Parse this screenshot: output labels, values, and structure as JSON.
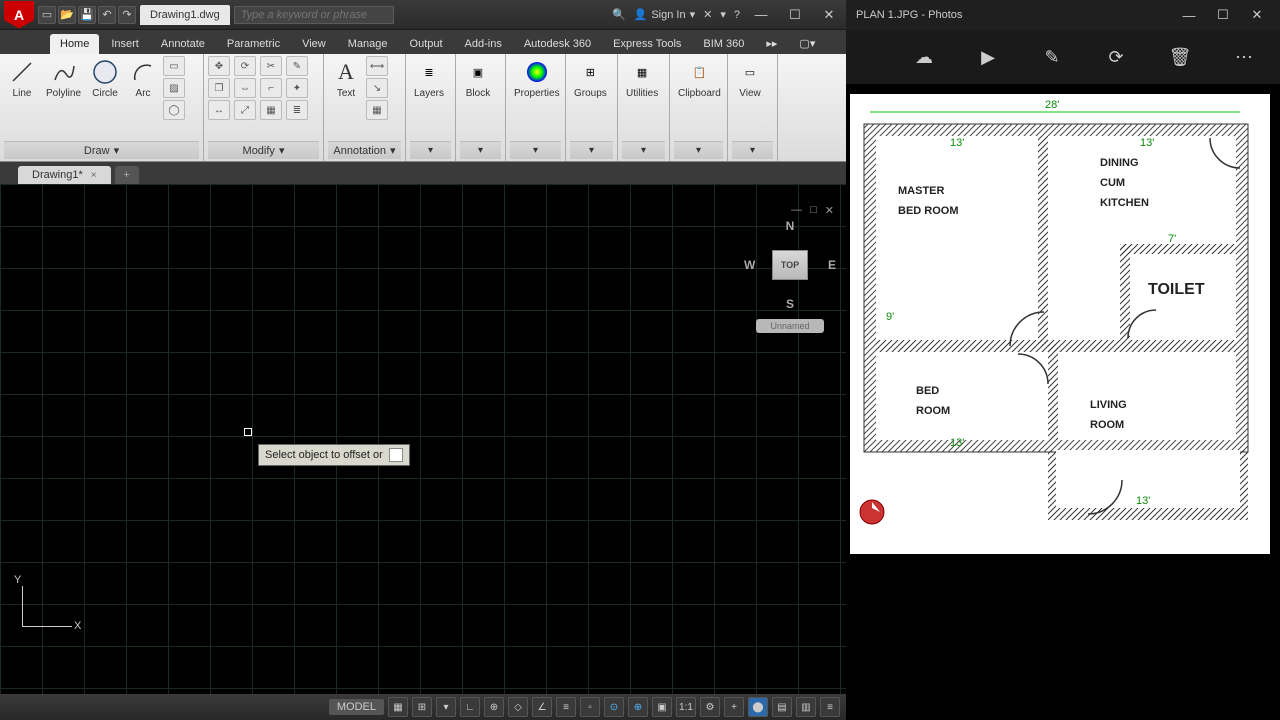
{
  "cad": {
    "title_tab": "Drawing1.dwg",
    "search_placeholder": "Type a keyword or phrase",
    "signin": "Sign In",
    "ribbon_tabs": [
      "Home",
      "Insert",
      "Annotate",
      "Parametric",
      "View",
      "Manage",
      "Output",
      "Add-ins",
      "Autodesk 360",
      "Express Tools",
      "BIM 360"
    ],
    "active_tab_index": 0,
    "panels": {
      "draw": {
        "title": "Draw",
        "big": [
          "Line",
          "Polyline",
          "Circle",
          "Arc"
        ]
      },
      "modify": {
        "title": "Modify"
      },
      "annotation": {
        "title": "Annotation",
        "big": [
          "Text"
        ]
      },
      "layers": {
        "title": "",
        "big": [
          "Layers"
        ]
      },
      "block": {
        "title": "",
        "big": [
          "Block"
        ]
      },
      "properties": {
        "title": "",
        "big": [
          "Properties"
        ]
      },
      "groups": {
        "title": "",
        "big": [
          "Groups"
        ]
      },
      "utilities": {
        "title": "",
        "big": [
          "Utilities"
        ]
      },
      "clipboard": {
        "title": "",
        "big": [
          "Clipboard"
        ]
      },
      "view": {
        "title": "",
        "big": [
          "View"
        ]
      }
    },
    "file_tab": "Drawing1*",
    "tooltip": "Select object to offset or",
    "viewcube": {
      "top": "TOP",
      "n": "N",
      "s": "S",
      "e": "E",
      "w": "W",
      "label": "Unnamed"
    },
    "ucs": {
      "x": "X",
      "y": "Y"
    },
    "status": {
      "model": "MODEL",
      "scale": "1:1"
    }
  },
  "photos": {
    "title": "PLAN 1.JPG - Photos",
    "floorplan": {
      "top_dim": "28'",
      "rooms": {
        "master_bed": "MASTER\nBED ROOM",
        "dining": "DINING\nCUM\nKITCHEN",
        "toilet": "TOILET",
        "bed": "BED\nROOM",
        "living": "LIVING\nROOM"
      },
      "dims": {
        "d13": "13'",
        "d7": "7'",
        "d9": "9'"
      }
    }
  }
}
